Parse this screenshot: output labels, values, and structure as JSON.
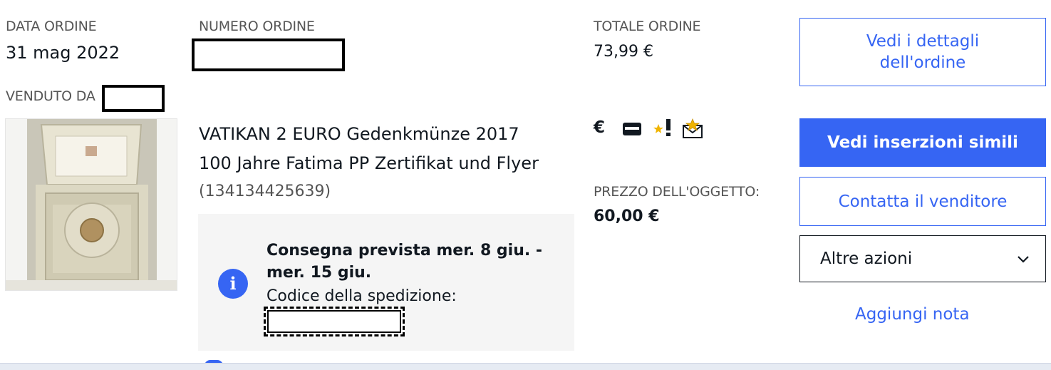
{
  "order": {
    "date_label": "DATA ORDINE",
    "date_value": "31 mag 2022",
    "number_label": "NUMERO ORDINE",
    "total_label": "TOTALE ORDINE",
    "total_value": "73,99 €",
    "seller_label": "VENDUTO DA"
  },
  "item": {
    "title_line1": "VATIKAN 2 EURO Gedenkmünze 2017",
    "title_line2": "100 Jahre Fatima PP Zertifikat und Flyer",
    "id": "(134134425639)",
    "price_label": "PREZZO DELL'OGGETTO:",
    "price_value": "60,00 €"
  },
  "shipping": {
    "info_symbol": "i",
    "delivery_line1": "Consegna prevista mer. 8 giu. -",
    "delivery_line2": "mer. 15 giu.",
    "code_label": "Codice della spedizione:"
  },
  "status_icons": [
    {
      "name": "euro-paid-icon",
      "glyph": "€"
    },
    {
      "name": "package-shipped-icon",
      "glyph": "▆"
    },
    {
      "name": "feedback-left-icon",
      "glyph": "★"
    },
    {
      "name": "feedback-received-icon",
      "glyph": "✉"
    }
  ],
  "actions": {
    "order_details_line1": "Vedi i dettagli",
    "order_details_line2": "dell'ordine",
    "similar": "Vedi inserzioni simili",
    "contact": "Contatta il venditore",
    "more_actions": "Altre azioni",
    "add_note": "Aggiungi nota"
  },
  "colors": {
    "accent": "#3665f3",
    "text": "#111820",
    "muted": "#555555",
    "panel": "#f5f5f5"
  }
}
